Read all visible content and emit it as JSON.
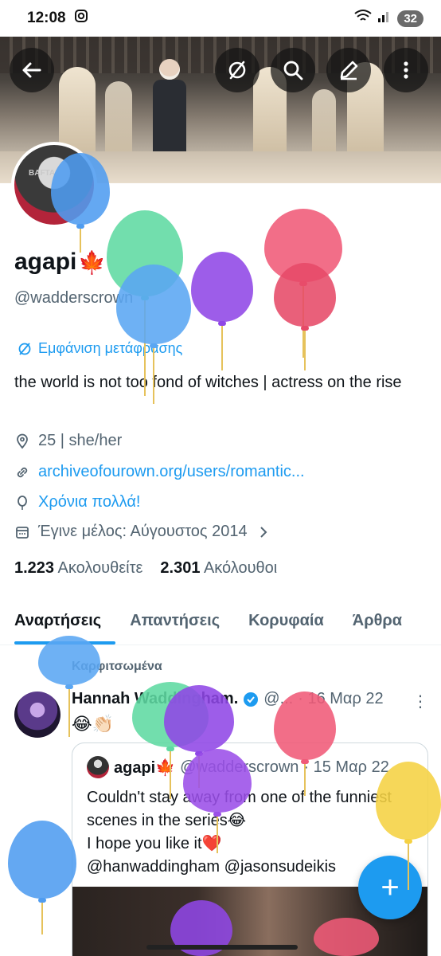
{
  "status_bar": {
    "time": "12:08",
    "battery": "32"
  },
  "header_icons": [
    "back-arrow-icon",
    "no-translate-icon",
    "search-icon",
    "edit-icon",
    "more-vertical-icon"
  ],
  "banner": {
    "avatar_text": "BAFTA"
  },
  "profile": {
    "name": "agapi",
    "name_emoji": "🍁",
    "handle": "@wadderscrown",
    "translate_label": "Εμφάνιση μετάφρασης",
    "bio": "the world is not too fond of witches | actress on the rise",
    "location": "25 | she/her",
    "website": "archiveofourown.org/users/romantic...",
    "birthday": "Χρόνια πολλά!",
    "joined": "Έγινε μέλος: Αύγουστος 2014",
    "following_count": "1.223",
    "following_label": "Ακολουθείτε",
    "followers_count": "2.301",
    "followers_label": "Ακόλουθοι"
  },
  "tabs": [
    "Αναρτήσεις",
    "Απαντήσεις",
    "Κορυφαία",
    "Άρθρα"
  ],
  "pinned_tweet": {
    "pinned_label": "Καρφιτσωμένα",
    "author": "Hannah Waddingham.",
    "handle_short": "@...",
    "date": "· 16 Μαρ 22",
    "emojis": "😂👏🏻",
    "quote": {
      "author": "agapi🍁",
      "handle": "@wadderscrown",
      "date": "· 15 Μαρ 22",
      "text": "Couldn't stay away from one of the funniest scenes in the series😂\nI hope you like it❤️\n@hanwaddingham @jasonsudeikis"
    }
  },
  "fab_label": "+",
  "colors": {
    "accent": "#1d9bf0",
    "text": "#0f1419",
    "muted": "#536471"
  }
}
